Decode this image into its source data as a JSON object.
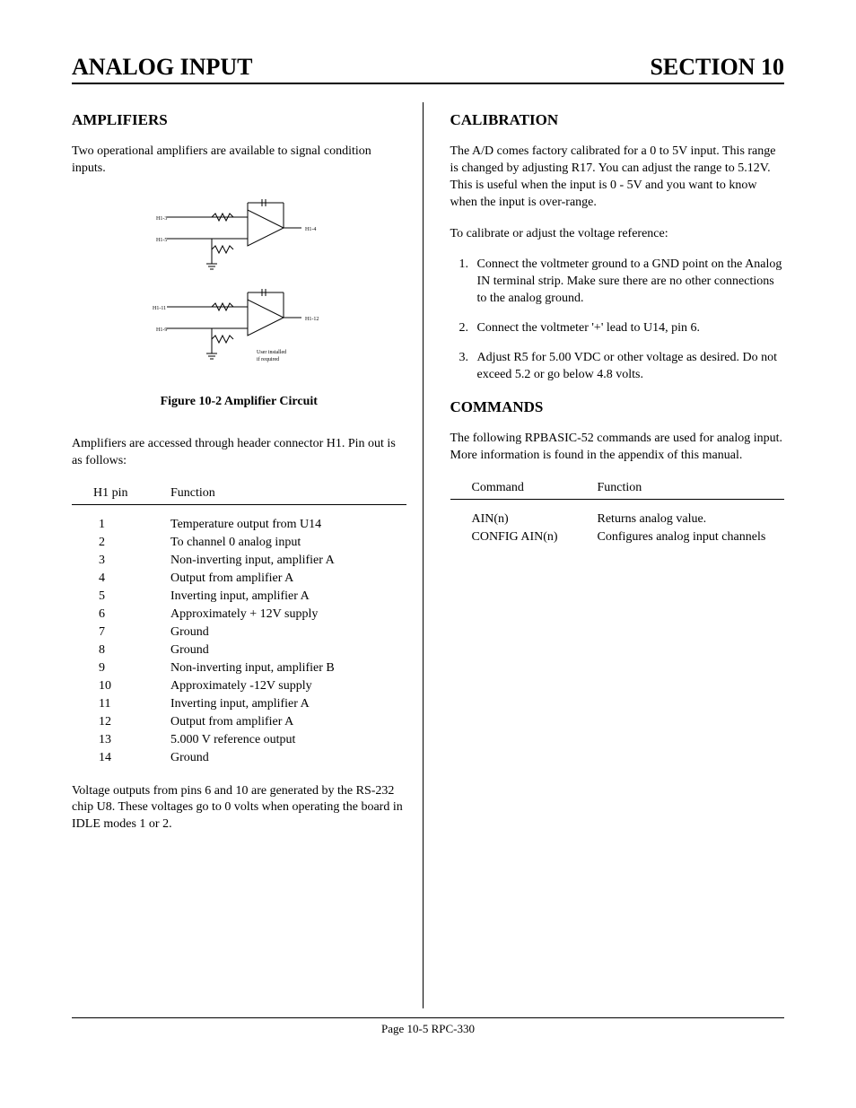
{
  "header": {
    "left": "ANALOG INPUT",
    "right": "SECTION 10"
  },
  "left": {
    "amplifiers_title": "AMPLIFIERS",
    "amplifiers_intro": "Two operational amplifiers are available to signal condition inputs.",
    "figure_caption": "Figure 10-2  Amplifier Circuit",
    "amplifiers_access": "Amplifiers are accessed through header connector H1. Pin out is as follows:",
    "pin_table": {
      "col_pin": "H1 pin",
      "col_func": "Function",
      "rows": [
        {
          "pin": "1",
          "func": "Temperature output from U14"
        },
        {
          "pin": "2",
          "func": "To channel 0 analog input"
        },
        {
          "pin": "3",
          "func": "Non-inverting input, amplifier A"
        },
        {
          "pin": "4",
          "func": "Output from amplifier A"
        },
        {
          "pin": "5",
          "func": "Inverting input, amplifier A"
        },
        {
          "pin": "6",
          "func": "Approximately + 12V supply"
        },
        {
          "pin": "7",
          "func": "Ground"
        },
        {
          "pin": "8",
          "func": "Ground"
        },
        {
          "pin": "9",
          "func": "Non-inverting input, amplifier B"
        },
        {
          "pin": "10",
          "func": "Approximately -12V supply"
        },
        {
          "pin": "11",
          "func": "Inverting input, amplifier A"
        },
        {
          "pin": "12",
          "func": "Output from amplifier A"
        },
        {
          "pin": "13",
          "func": "5.000 V reference output"
        },
        {
          "pin": "14",
          "func": "Ground"
        }
      ]
    },
    "voltage_note": "Voltage outputs from pins 6 and 10 are generated by the RS-232 chip U8.  These voltages go to 0 volts when operating the board in IDLE modes 1 or 2."
  },
  "right": {
    "calibration_title": "CALIBRATION",
    "calibration_p1": "The A/D comes factory calibrated for a 0 to 5V input. This range is changed by adjusting R17.  You can adjust the range to 5.12V.  This is useful when the input is 0 - 5V and you want to know when the input is over-range.",
    "calibration_p2": "To calibrate or adjust the voltage reference:",
    "steps": [
      "Connect the voltmeter ground to a GND point on the Analog IN terminal strip.  Make sure there are no other connections to the analog ground.",
      "Connect the voltmeter '+' lead to U14, pin 6.",
      "Adjust R5 for 5.00 VDC or other voltage as desired.  Do not exceed 5.2 or go below 4.8 volts."
    ],
    "commands_title": "COMMANDS",
    "commands_intro": "The following RPBASIC-52 commands are used for analog input.  More information is found in the appendix of this manual.",
    "cmd_table": {
      "col_cmd": "Command",
      "col_func": "Function",
      "rows": [
        {
          "cmd": "AIN(n)",
          "func": "Returns analog value."
        },
        {
          "cmd": "CONFIG AIN(n)",
          "func": "Configures analog input channels"
        }
      ]
    }
  },
  "footer": "Page 10-5  RPC-330"
}
